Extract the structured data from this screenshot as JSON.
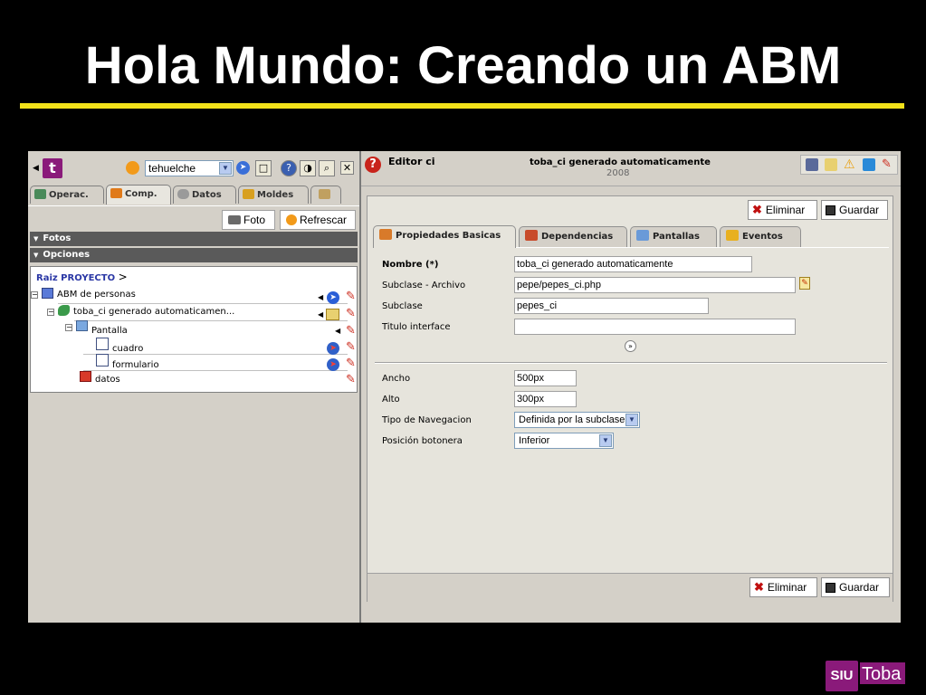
{
  "slide": {
    "title": "Hola Mundo: Creando un ABM"
  },
  "left_panel": {
    "project_select": "tehuelche",
    "tabs": [
      {
        "label": "Operac."
      },
      {
        "label": "Comp."
      },
      {
        "label": "Datos"
      },
      {
        "label": "Moldes"
      }
    ],
    "buttons": {
      "foto": "Foto",
      "refrescar": "Refrescar"
    },
    "sections": {
      "fotos": "Fotos",
      "opciones": "Opciones"
    },
    "breadcrumb": {
      "root": "Raiz PROYECTO",
      "sep": ">"
    },
    "tree": {
      "abm": "ABM de personas",
      "ci": "toba_ci generado automaticamen...",
      "pantalla": "Pantalla",
      "cuadro": "cuadro",
      "formulario": "formulario",
      "datos": "datos"
    }
  },
  "right_panel": {
    "editor_label": "Editor ci",
    "editor_name": "toba_ci generado automaticamente",
    "editor_year": "2008",
    "buttons": {
      "eliminar": "Eliminar",
      "guardar": "Guardar"
    },
    "tabs": [
      {
        "label": "Propiedades Basicas"
      },
      {
        "label": "Dependencias"
      },
      {
        "label": "Pantallas"
      },
      {
        "label": "Eventos"
      }
    ],
    "form": {
      "nombre": {
        "label": "Nombre (*)",
        "value": "toba_ci generado automaticamente"
      },
      "subclase_archivo": {
        "label": "Subclase - Archivo",
        "value": "pepe/pepes_ci.php"
      },
      "subclase": {
        "label": "Subclase",
        "value": "pepes_ci"
      },
      "titulo_interface": {
        "label": "Titulo interface",
        "value": ""
      },
      "ancho": {
        "label": "Ancho",
        "value": "500px"
      },
      "alto": {
        "label": "Alto",
        "value": "300px"
      },
      "tipo_navegacion": {
        "label": "Tipo de Navegacion",
        "value": "Definida por la subclase"
      },
      "posicion_botonera": {
        "label": "Posición botonera",
        "value": "Inferior"
      }
    }
  },
  "logo": {
    "siu": "SIU",
    "toba": "Toba"
  }
}
